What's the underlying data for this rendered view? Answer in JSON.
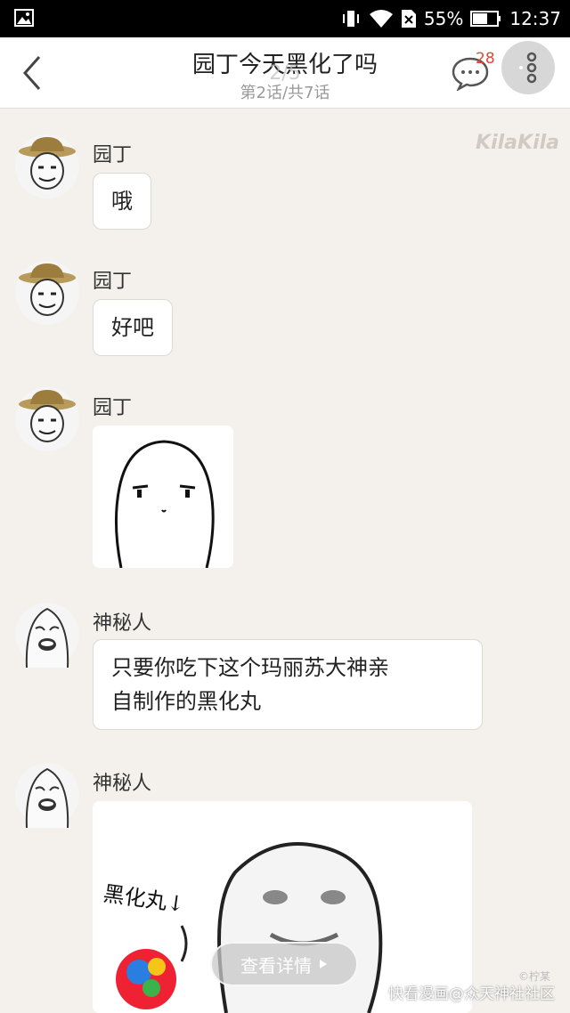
{
  "status_bar": {
    "battery": "55%",
    "time": "12:37"
  },
  "header": {
    "title": "园丁今天黑化了吗",
    "subtitle": "第2话/共7话",
    "page_indicator": "2/5",
    "comment_count": "28"
  },
  "watermark": "KilaKila",
  "messages": [
    {
      "sender": "园丁",
      "text": "哦"
    },
    {
      "sender": "园丁",
      "text": "好吧"
    },
    {
      "sender": "园丁",
      "image": "blank-face-sticker"
    },
    {
      "sender": "神秘人",
      "text": "只要你吃下这个玛丽苏大神亲\n自制作的黑化丸"
    },
    {
      "sender": "神秘人",
      "image": "black-pill-sticker",
      "image_caption": "黑化丸↓"
    }
  ],
  "details_button": "查看详情",
  "bottom_watermark": "快看漫画@众天神社社区",
  "bottom_watermark_small": "©柠某"
}
